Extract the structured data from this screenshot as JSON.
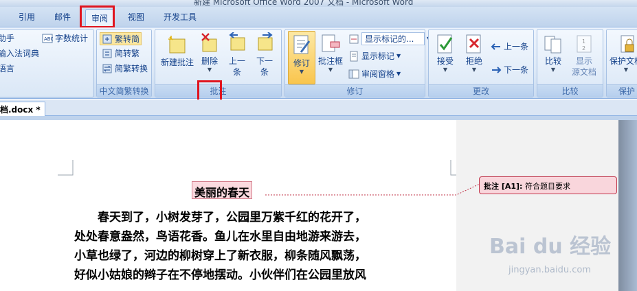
{
  "window": {
    "title": "新建 Microsoft Office Word 2007 文档 - Microsoft Word"
  },
  "tabs": [
    {
      "label": "引用"
    },
    {
      "label": "邮件"
    },
    {
      "label": "审阅"
    },
    {
      "label": "视图"
    },
    {
      "label": "开发工具"
    }
  ],
  "ribbon": {
    "proofing": {
      "items": [
        "助手",
        "输入法词典",
        "语言"
      ],
      "word_count": "字数统计"
    },
    "chinese_conversion": {
      "label": "中文简繁转换",
      "to_simplified": "繁转简",
      "to_traditional": "简转繁",
      "convert": "简繁转换"
    },
    "comments": {
      "label": "批注",
      "new": "新建批注",
      "delete": "删除",
      "prev_1": "上一",
      "prev_2": "条",
      "next_1": "下一",
      "next_2": "条"
    },
    "tracking": {
      "label": "修订",
      "track": "修订",
      "balloons": "批注框",
      "display_dropdown": "显示标记的...",
      "show_markup": "显示标记",
      "reviewing_pane": "审阅窗格"
    },
    "changes": {
      "label": "更改",
      "accept": "接受",
      "reject": "拒绝",
      "previous": "上一条",
      "next": "下一条"
    },
    "compare": {
      "label": "比较",
      "compare": "比较",
      "show_source_1": "显示",
      "show_source_2": "源文档"
    },
    "protect": {
      "label": "保护",
      "protect_doc": "保护文档"
    }
  },
  "doc_tab": {
    "name": "档.docx *"
  },
  "document": {
    "title": "美丽的春天",
    "lines": [
      "　　春天到了，小树发芽了，公园里万紫千红的花开了，",
      "处处春意盎然，鸟语花香。鱼儿在水里自由地游来游去，",
      "小草也绿了，河边的柳树穿上了新衣服，柳条随风飘荡，",
      "好似小姑娘的辫子在不停地摆动。小伙伴们在公园里放风"
    ]
  },
  "comment": {
    "tag": "批注 [A1]:",
    "text": "符合题目要求"
  },
  "watermark": {
    "main": "Bai du 经验",
    "sub": "jingyan.baidu.com"
  }
}
